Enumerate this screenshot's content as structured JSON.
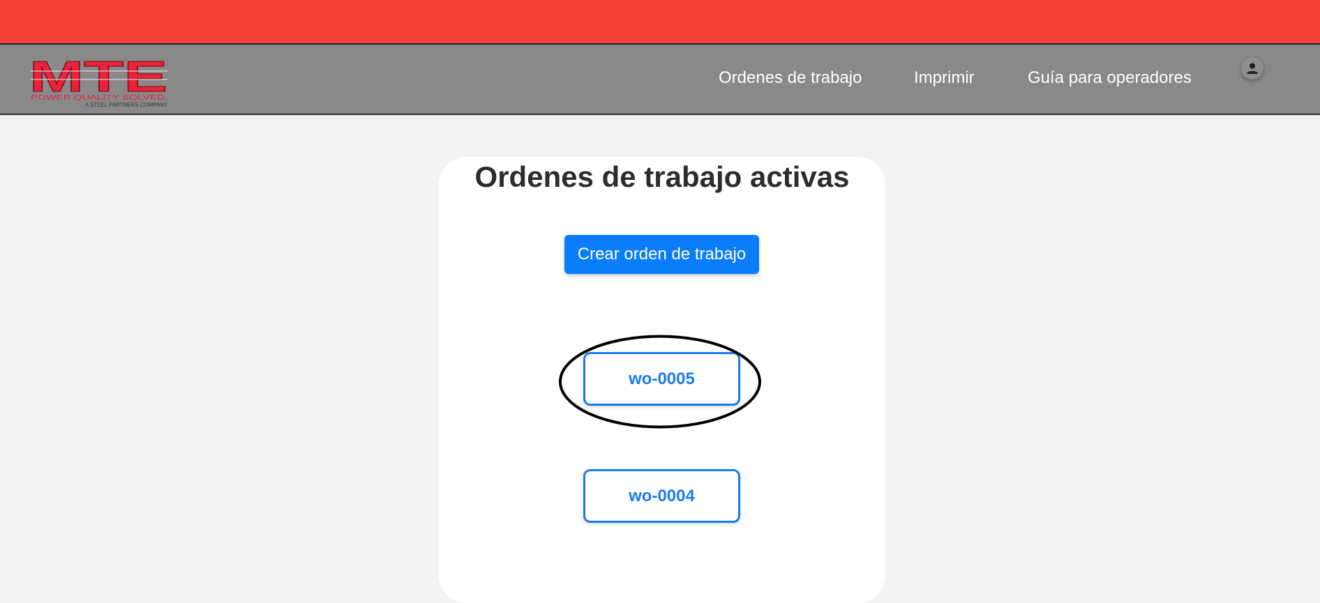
{
  "colors": {
    "top_bar": "#f44336",
    "navbar": "#898989",
    "page_background": "#f3f3f3",
    "primary_button": "#0b7dfa",
    "work_order_accent": "#1a7bf0",
    "logo_red": "#e8233c"
  },
  "logo": {
    "text": "MTE",
    "tagline": "POWER QUALITY SOLVED.",
    "subtagline": "A STEEL PARTNERS COMPANY"
  },
  "nav": {
    "items": [
      {
        "label": "Ordenes de trabajo"
      },
      {
        "label": "Imprimir"
      },
      {
        "label": "Guía para operadores"
      }
    ],
    "user_icon": "user-icon"
  },
  "main": {
    "title": "Ordenes de trabajo activas",
    "create_button": "Crear orden de trabajo",
    "work_orders": [
      {
        "id": "wo-0005",
        "highlighted": true
      },
      {
        "id": "wo-0004",
        "highlighted": false
      }
    ]
  }
}
